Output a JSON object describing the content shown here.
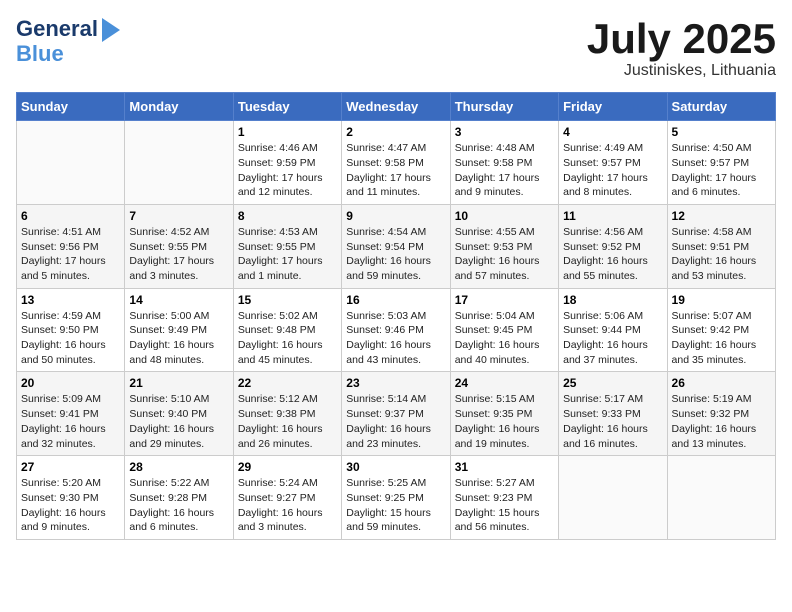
{
  "header": {
    "logo_line1": "General",
    "logo_line2": "Blue",
    "month_title": "July 2025",
    "location": "Justiniskes, Lithuania"
  },
  "days_of_week": [
    "Sunday",
    "Monday",
    "Tuesday",
    "Wednesday",
    "Thursday",
    "Friday",
    "Saturday"
  ],
  "weeks": [
    [
      {
        "day": "",
        "content": ""
      },
      {
        "day": "",
        "content": ""
      },
      {
        "day": "1",
        "content": "Sunrise: 4:46 AM\nSunset: 9:59 PM\nDaylight: 17 hours and 12 minutes."
      },
      {
        "day": "2",
        "content": "Sunrise: 4:47 AM\nSunset: 9:58 PM\nDaylight: 17 hours and 11 minutes."
      },
      {
        "day": "3",
        "content": "Sunrise: 4:48 AM\nSunset: 9:58 PM\nDaylight: 17 hours and 9 minutes."
      },
      {
        "day": "4",
        "content": "Sunrise: 4:49 AM\nSunset: 9:57 PM\nDaylight: 17 hours and 8 minutes."
      },
      {
        "day": "5",
        "content": "Sunrise: 4:50 AM\nSunset: 9:57 PM\nDaylight: 17 hours and 6 minutes."
      }
    ],
    [
      {
        "day": "6",
        "content": "Sunrise: 4:51 AM\nSunset: 9:56 PM\nDaylight: 17 hours and 5 minutes."
      },
      {
        "day": "7",
        "content": "Sunrise: 4:52 AM\nSunset: 9:55 PM\nDaylight: 17 hours and 3 minutes."
      },
      {
        "day": "8",
        "content": "Sunrise: 4:53 AM\nSunset: 9:55 PM\nDaylight: 17 hours and 1 minute."
      },
      {
        "day": "9",
        "content": "Sunrise: 4:54 AM\nSunset: 9:54 PM\nDaylight: 16 hours and 59 minutes."
      },
      {
        "day": "10",
        "content": "Sunrise: 4:55 AM\nSunset: 9:53 PM\nDaylight: 16 hours and 57 minutes."
      },
      {
        "day": "11",
        "content": "Sunrise: 4:56 AM\nSunset: 9:52 PM\nDaylight: 16 hours and 55 minutes."
      },
      {
        "day": "12",
        "content": "Sunrise: 4:58 AM\nSunset: 9:51 PM\nDaylight: 16 hours and 53 minutes."
      }
    ],
    [
      {
        "day": "13",
        "content": "Sunrise: 4:59 AM\nSunset: 9:50 PM\nDaylight: 16 hours and 50 minutes."
      },
      {
        "day": "14",
        "content": "Sunrise: 5:00 AM\nSunset: 9:49 PM\nDaylight: 16 hours and 48 minutes."
      },
      {
        "day": "15",
        "content": "Sunrise: 5:02 AM\nSunset: 9:48 PM\nDaylight: 16 hours and 45 minutes."
      },
      {
        "day": "16",
        "content": "Sunrise: 5:03 AM\nSunset: 9:46 PM\nDaylight: 16 hours and 43 minutes."
      },
      {
        "day": "17",
        "content": "Sunrise: 5:04 AM\nSunset: 9:45 PM\nDaylight: 16 hours and 40 minutes."
      },
      {
        "day": "18",
        "content": "Sunrise: 5:06 AM\nSunset: 9:44 PM\nDaylight: 16 hours and 37 minutes."
      },
      {
        "day": "19",
        "content": "Sunrise: 5:07 AM\nSunset: 9:42 PM\nDaylight: 16 hours and 35 minutes."
      }
    ],
    [
      {
        "day": "20",
        "content": "Sunrise: 5:09 AM\nSunset: 9:41 PM\nDaylight: 16 hours and 32 minutes."
      },
      {
        "day": "21",
        "content": "Sunrise: 5:10 AM\nSunset: 9:40 PM\nDaylight: 16 hours and 29 minutes."
      },
      {
        "day": "22",
        "content": "Sunrise: 5:12 AM\nSunset: 9:38 PM\nDaylight: 16 hours and 26 minutes."
      },
      {
        "day": "23",
        "content": "Sunrise: 5:14 AM\nSunset: 9:37 PM\nDaylight: 16 hours and 23 minutes."
      },
      {
        "day": "24",
        "content": "Sunrise: 5:15 AM\nSunset: 9:35 PM\nDaylight: 16 hours and 19 minutes."
      },
      {
        "day": "25",
        "content": "Sunrise: 5:17 AM\nSunset: 9:33 PM\nDaylight: 16 hours and 16 minutes."
      },
      {
        "day": "26",
        "content": "Sunrise: 5:19 AM\nSunset: 9:32 PM\nDaylight: 16 hours and 13 minutes."
      }
    ],
    [
      {
        "day": "27",
        "content": "Sunrise: 5:20 AM\nSunset: 9:30 PM\nDaylight: 16 hours and 9 minutes."
      },
      {
        "day": "28",
        "content": "Sunrise: 5:22 AM\nSunset: 9:28 PM\nDaylight: 16 hours and 6 minutes."
      },
      {
        "day": "29",
        "content": "Sunrise: 5:24 AM\nSunset: 9:27 PM\nDaylight: 16 hours and 3 minutes."
      },
      {
        "day": "30",
        "content": "Sunrise: 5:25 AM\nSunset: 9:25 PM\nDaylight: 15 hours and 59 minutes."
      },
      {
        "day": "31",
        "content": "Sunrise: 5:27 AM\nSunset: 9:23 PM\nDaylight: 15 hours and 56 minutes."
      },
      {
        "day": "",
        "content": ""
      },
      {
        "day": "",
        "content": ""
      }
    ]
  ]
}
